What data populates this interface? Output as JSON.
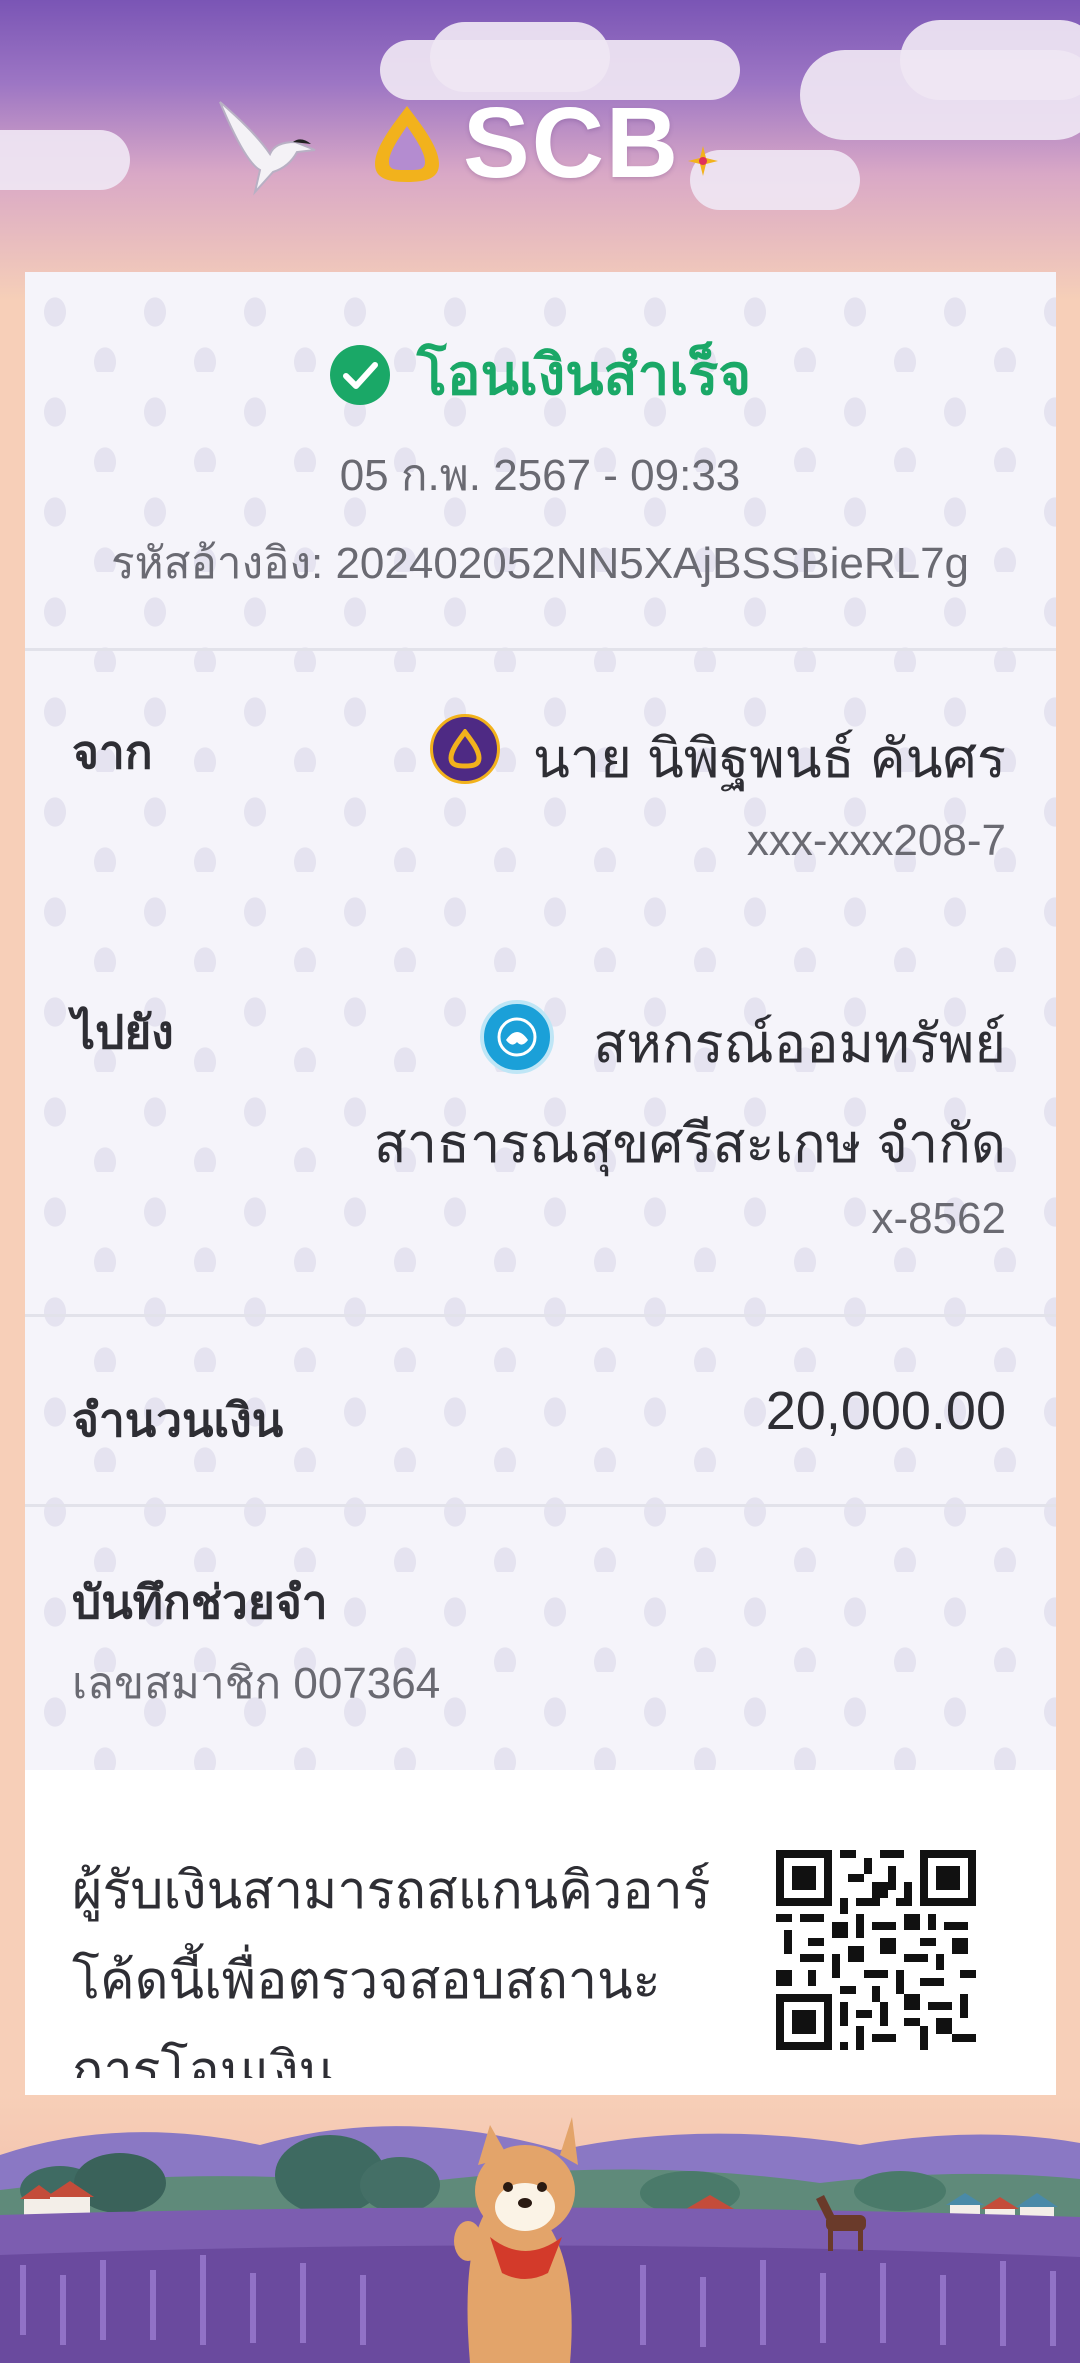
{
  "brand": {
    "name": "SCB",
    "accent_color": "#7a55b5",
    "logo_color": "#f2b21c"
  },
  "status": {
    "icon": "check-circle-icon",
    "text": "โอนเงินสำเร็จ",
    "color": "#1aa867"
  },
  "datetime": "05 ก.พ. 2567 - 09:33",
  "reference": "รหัสอ้างอิง: 202402052NN5XAjBSSBieRL7g",
  "from": {
    "label": "จาก",
    "name": "นาย นิพิฐพนธ์ คันศร",
    "account": "xxx-xxx208-7",
    "bank_icon": "scb-bank-icon"
  },
  "to": {
    "label": "ไปยัง",
    "name_line1": "สหกรณ์ออมทรัพย์",
    "name_line2": "สาธารณสุขศรีสะเกษ จำกัด",
    "account": "x-8562",
    "bank_icon": "krungthai-bank-icon"
  },
  "amount": {
    "label": "จำนวนเงิน",
    "value": "20,000.00"
  },
  "memo": {
    "label": "บันทึกช่วยจำ",
    "value": "เลขสมาชิก 007364"
  },
  "qr": {
    "line1": "ผู้รับเงินสามารถสแกนคิวอาร์",
    "line2": "โค้ดนี้เพื่อตรวจสอบสถานะ",
    "line3": "การโอนเงิน",
    "icon": "qr-code-icon"
  }
}
